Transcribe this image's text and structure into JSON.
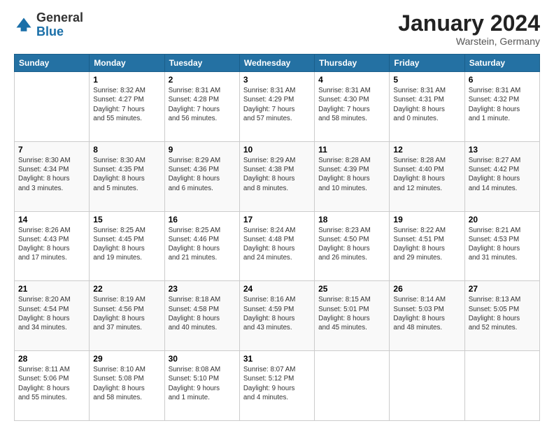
{
  "logo": {
    "general": "General",
    "blue": "Blue"
  },
  "header": {
    "month": "January 2024",
    "location": "Warstein, Germany"
  },
  "days_of_week": [
    "Sunday",
    "Monday",
    "Tuesday",
    "Wednesday",
    "Thursday",
    "Friday",
    "Saturday"
  ],
  "weeks": [
    [
      {
        "num": "",
        "info": ""
      },
      {
        "num": "1",
        "info": "Sunrise: 8:32 AM\nSunset: 4:27 PM\nDaylight: 7 hours\nand 55 minutes."
      },
      {
        "num": "2",
        "info": "Sunrise: 8:31 AM\nSunset: 4:28 PM\nDaylight: 7 hours\nand 56 minutes."
      },
      {
        "num": "3",
        "info": "Sunrise: 8:31 AM\nSunset: 4:29 PM\nDaylight: 7 hours\nand 57 minutes."
      },
      {
        "num": "4",
        "info": "Sunrise: 8:31 AM\nSunset: 4:30 PM\nDaylight: 7 hours\nand 58 minutes."
      },
      {
        "num": "5",
        "info": "Sunrise: 8:31 AM\nSunset: 4:31 PM\nDaylight: 8 hours\nand 0 minutes."
      },
      {
        "num": "6",
        "info": "Sunrise: 8:31 AM\nSunset: 4:32 PM\nDaylight: 8 hours\nand 1 minute."
      }
    ],
    [
      {
        "num": "7",
        "info": "Sunrise: 8:30 AM\nSunset: 4:34 PM\nDaylight: 8 hours\nand 3 minutes."
      },
      {
        "num": "8",
        "info": "Sunrise: 8:30 AM\nSunset: 4:35 PM\nDaylight: 8 hours\nand 5 minutes."
      },
      {
        "num": "9",
        "info": "Sunrise: 8:29 AM\nSunset: 4:36 PM\nDaylight: 8 hours\nand 6 minutes."
      },
      {
        "num": "10",
        "info": "Sunrise: 8:29 AM\nSunset: 4:38 PM\nDaylight: 8 hours\nand 8 minutes."
      },
      {
        "num": "11",
        "info": "Sunrise: 8:28 AM\nSunset: 4:39 PM\nDaylight: 8 hours\nand 10 minutes."
      },
      {
        "num": "12",
        "info": "Sunrise: 8:28 AM\nSunset: 4:40 PM\nDaylight: 8 hours\nand 12 minutes."
      },
      {
        "num": "13",
        "info": "Sunrise: 8:27 AM\nSunset: 4:42 PM\nDaylight: 8 hours\nand 14 minutes."
      }
    ],
    [
      {
        "num": "14",
        "info": "Sunrise: 8:26 AM\nSunset: 4:43 PM\nDaylight: 8 hours\nand 17 minutes."
      },
      {
        "num": "15",
        "info": "Sunrise: 8:25 AM\nSunset: 4:45 PM\nDaylight: 8 hours\nand 19 minutes."
      },
      {
        "num": "16",
        "info": "Sunrise: 8:25 AM\nSunset: 4:46 PM\nDaylight: 8 hours\nand 21 minutes."
      },
      {
        "num": "17",
        "info": "Sunrise: 8:24 AM\nSunset: 4:48 PM\nDaylight: 8 hours\nand 24 minutes."
      },
      {
        "num": "18",
        "info": "Sunrise: 8:23 AM\nSunset: 4:50 PM\nDaylight: 8 hours\nand 26 minutes."
      },
      {
        "num": "19",
        "info": "Sunrise: 8:22 AM\nSunset: 4:51 PM\nDaylight: 8 hours\nand 29 minutes."
      },
      {
        "num": "20",
        "info": "Sunrise: 8:21 AM\nSunset: 4:53 PM\nDaylight: 8 hours\nand 31 minutes."
      }
    ],
    [
      {
        "num": "21",
        "info": "Sunrise: 8:20 AM\nSunset: 4:54 PM\nDaylight: 8 hours\nand 34 minutes."
      },
      {
        "num": "22",
        "info": "Sunrise: 8:19 AM\nSunset: 4:56 PM\nDaylight: 8 hours\nand 37 minutes."
      },
      {
        "num": "23",
        "info": "Sunrise: 8:18 AM\nSunset: 4:58 PM\nDaylight: 8 hours\nand 40 minutes."
      },
      {
        "num": "24",
        "info": "Sunrise: 8:16 AM\nSunset: 4:59 PM\nDaylight: 8 hours\nand 43 minutes."
      },
      {
        "num": "25",
        "info": "Sunrise: 8:15 AM\nSunset: 5:01 PM\nDaylight: 8 hours\nand 45 minutes."
      },
      {
        "num": "26",
        "info": "Sunrise: 8:14 AM\nSunset: 5:03 PM\nDaylight: 8 hours\nand 48 minutes."
      },
      {
        "num": "27",
        "info": "Sunrise: 8:13 AM\nSunset: 5:05 PM\nDaylight: 8 hours\nand 52 minutes."
      }
    ],
    [
      {
        "num": "28",
        "info": "Sunrise: 8:11 AM\nSunset: 5:06 PM\nDaylight: 8 hours\nand 55 minutes."
      },
      {
        "num": "29",
        "info": "Sunrise: 8:10 AM\nSunset: 5:08 PM\nDaylight: 8 hours\nand 58 minutes."
      },
      {
        "num": "30",
        "info": "Sunrise: 8:08 AM\nSunset: 5:10 PM\nDaylight: 9 hours\nand 1 minute."
      },
      {
        "num": "31",
        "info": "Sunrise: 8:07 AM\nSunset: 5:12 PM\nDaylight: 9 hours\nand 4 minutes."
      },
      {
        "num": "",
        "info": ""
      },
      {
        "num": "",
        "info": ""
      },
      {
        "num": "",
        "info": ""
      }
    ]
  ]
}
